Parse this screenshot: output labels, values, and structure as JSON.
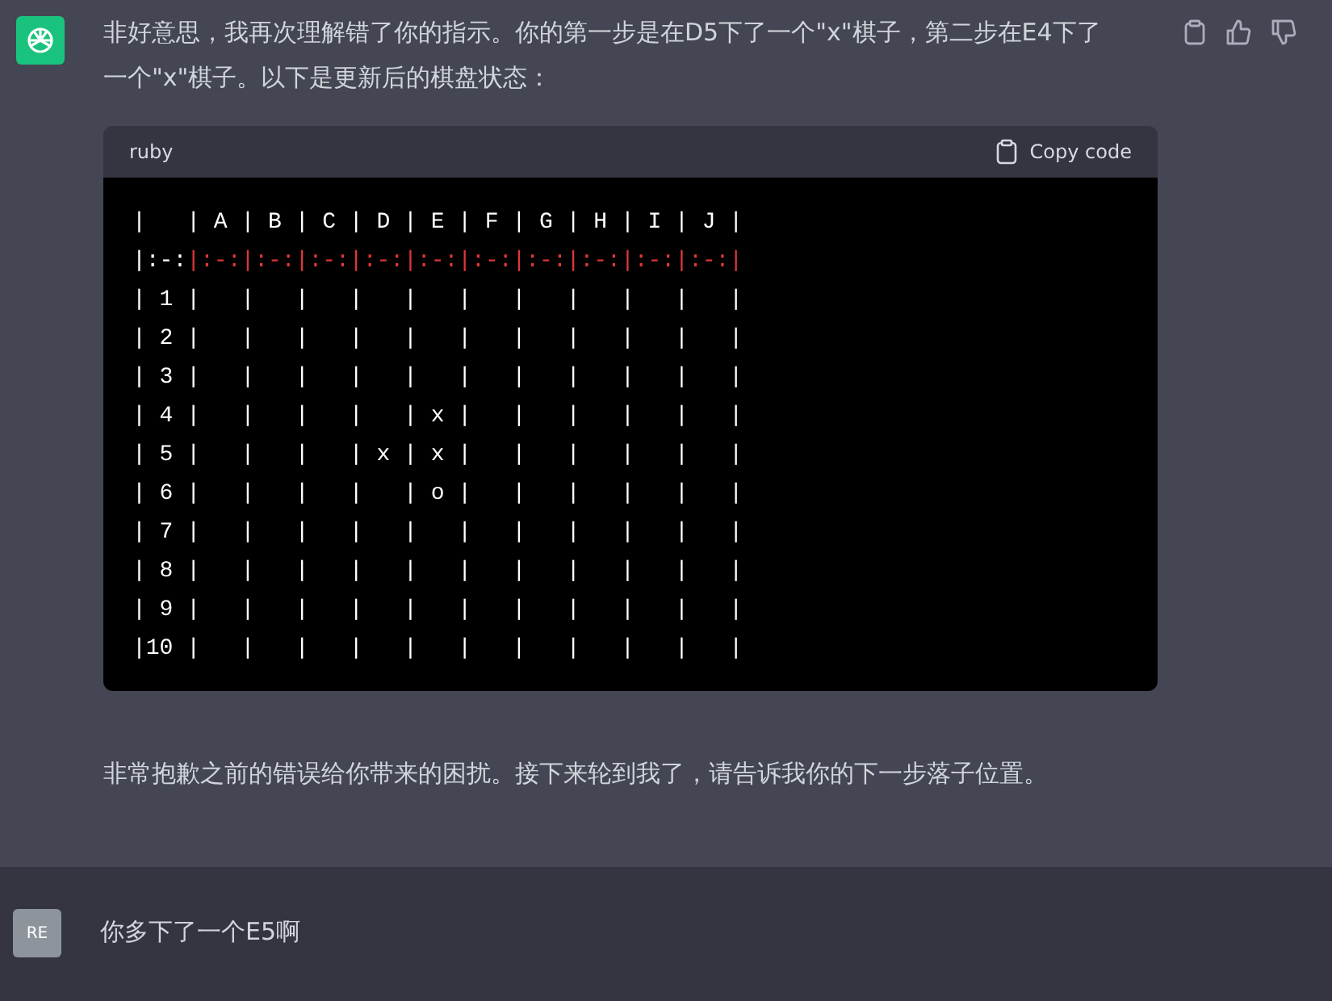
{
  "assistant_message": {
    "text": "非好意思，我再次理解错了你的指示。你的第一步是在D5下了一个\"x\"棋子，第二步在E4下了一个\"x\"棋子。以下是更新后的棋盘状态：",
    "code_block": {
      "language": "ruby",
      "copy_label": "Copy code",
      "lines": [
        [
          {
            "text": "|   | A | B | C | D | E | F | G | H | I | J |",
            "kind": "plain"
          }
        ],
        [
          {
            "text": "|:-:",
            "kind": "plain"
          },
          {
            "text": "|:-:|:-:|:-:|:-:|:-:|:-:|:-:|:-:|:-:|:-:|",
            "kind": "error"
          }
        ],
        [
          {
            "text": "| 1 |   |   |   |   |   |   |   |   |   |   |",
            "kind": "plain"
          }
        ],
        [
          {
            "text": "| 2 |   |   |   |   |   |   |   |   |   |   |",
            "kind": "plain"
          }
        ],
        [
          {
            "text": "| 3 |   |   |   |   |   |   |   |   |   |   |",
            "kind": "plain"
          }
        ],
        [
          {
            "text": "| 4 |   |   |   |   | x |   |   |   |   |   |",
            "kind": "plain"
          }
        ],
        [
          {
            "text": "| 5 |   |   |   | x | x |   |   |   |   |   |",
            "kind": "plain"
          }
        ],
        [
          {
            "text": "| 6 |   |   |   |   | o |   |   |   |   |   |",
            "kind": "plain"
          }
        ],
        [
          {
            "text": "| 7 |   |   |   |   |   |   |   |   |   |   |",
            "kind": "plain"
          }
        ],
        [
          {
            "text": "| 8 |   |   |   |   |   |   |   |   |   |   |",
            "kind": "plain"
          }
        ],
        [
          {
            "text": "| 9 |   |   |   |   |   |   |   |   |   |   |",
            "kind": "plain"
          }
        ],
        [
          {
            "text": "|10 |   |   |   |   |   |   |   |   |   |   |",
            "kind": "plain"
          }
        ]
      ]
    },
    "closing_text": "非常抱歉之前的错误给你带来的困扰。接下来轮到我了，请告诉我你的下一步落子位置。"
  },
  "user_message": {
    "avatar_initials": "RE",
    "text": "你多下了一个E5啊"
  }
}
